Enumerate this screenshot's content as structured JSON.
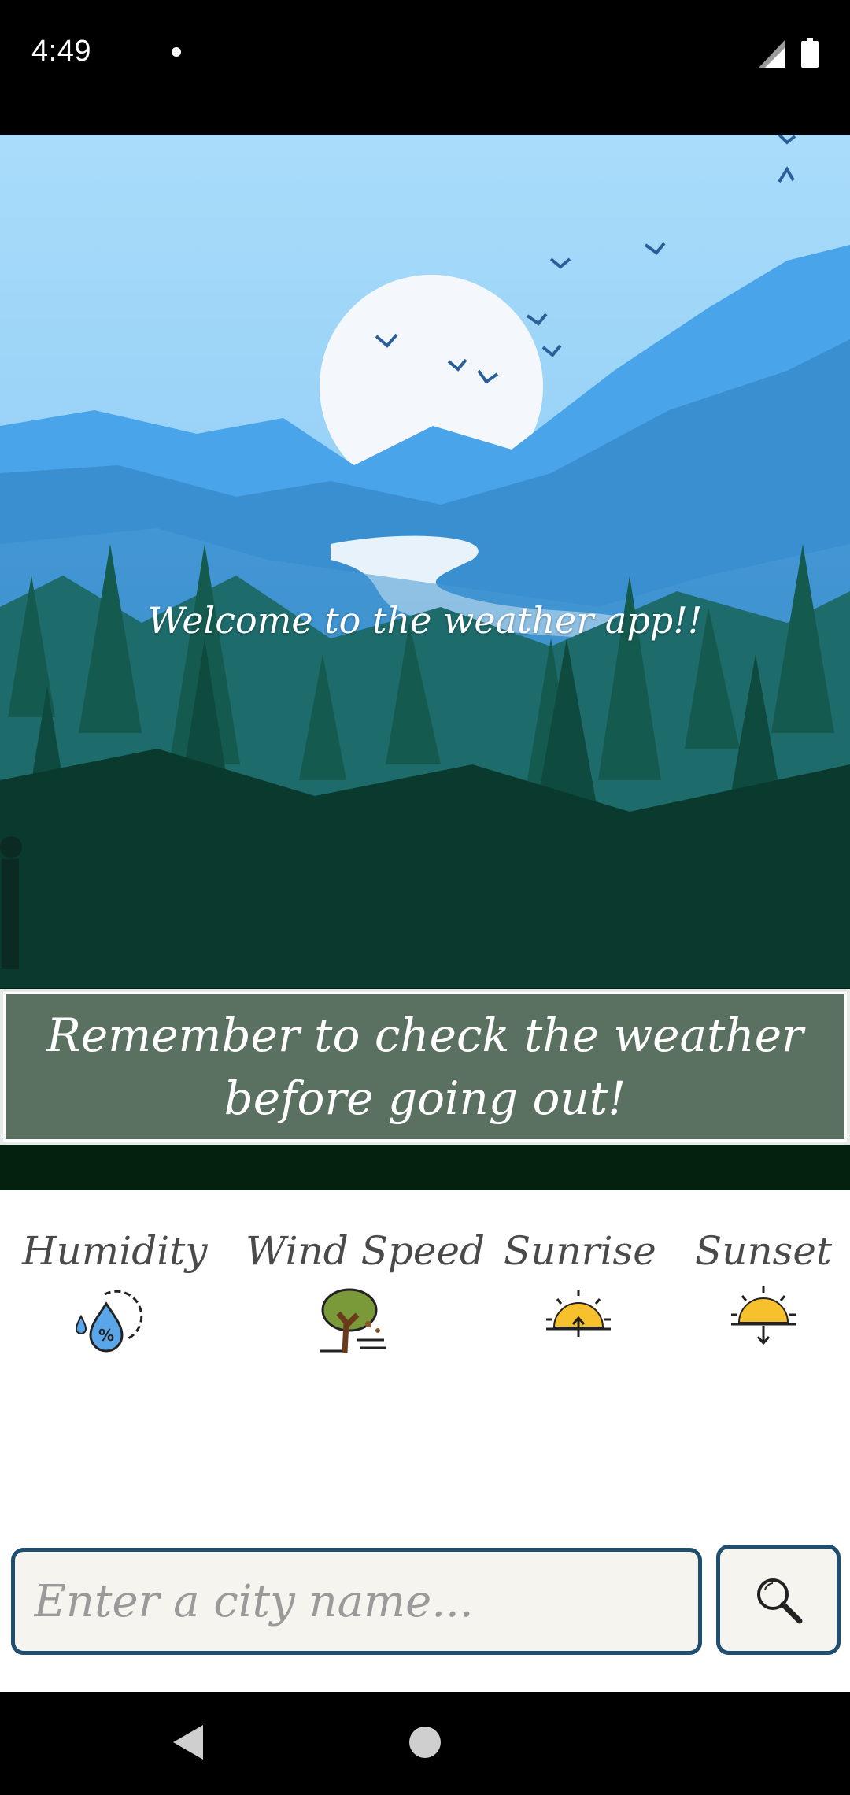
{
  "status_bar": {
    "time": "4:49",
    "icons": [
      "notification-dot-icon",
      "signal-icon",
      "battery-icon"
    ]
  },
  "hero": {
    "welcome_text": "Welcome to the weather app!!",
    "banner_text": "Remember to check the weather before going out!"
  },
  "metrics": [
    {
      "label": "Humidity",
      "icon": "humidity-icon"
    },
    {
      "label": "Wind Speed",
      "icon": "wind-tree-icon"
    },
    {
      "label": "Sunrise",
      "icon": "sunrise-icon"
    },
    {
      "label": "Sunset",
      "icon": "sunset-icon"
    }
  ],
  "search": {
    "placeholder": "Enter a city name...",
    "value": "",
    "button_icon": "search-icon"
  },
  "nav_bar": {
    "icons": [
      "back-icon",
      "home-icon"
    ]
  },
  "colors": {
    "accent_border": "#1f4e6e",
    "banner_bg": "#5a7060",
    "sky": "#8fd0f8",
    "forest": "#0d4a3a"
  }
}
